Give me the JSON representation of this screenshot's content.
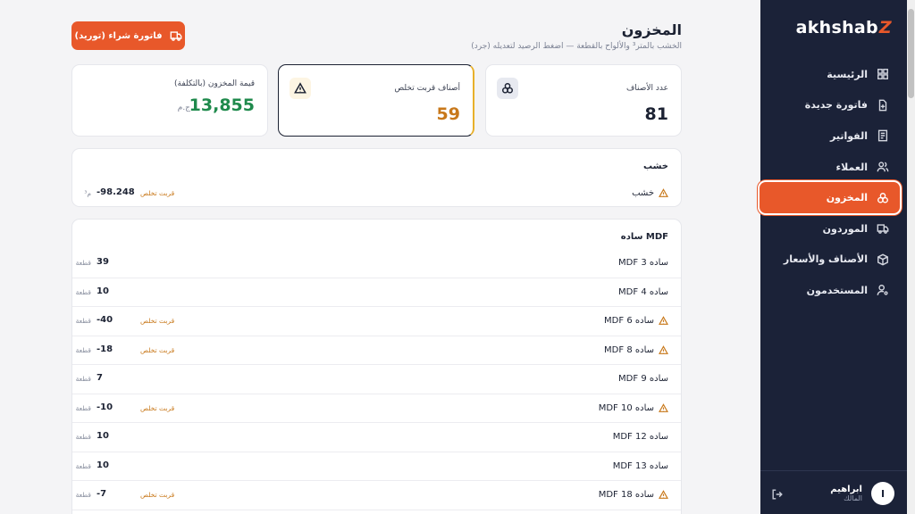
{
  "sidebar": {
    "logo_text": "akhshab",
    "logo_mark": "Z",
    "items": [
      {
        "label": "الرئيسية",
        "icon": "grid-icon"
      },
      {
        "label": "فاتورة جديدة",
        "icon": "file-plus-icon"
      },
      {
        "label": "الفواتير",
        "icon": "receipt-icon"
      },
      {
        "label": "العملاء",
        "icon": "users-icon"
      },
      {
        "label": "المخزون",
        "icon": "layers-icon",
        "active": true
      },
      {
        "label": "الموردون",
        "icon": "truck-icon"
      },
      {
        "label": "الأصناف والأسعار",
        "icon": "box-icon"
      },
      {
        "label": "المستخدمون",
        "icon": "user-cog-icon"
      }
    ],
    "user": {
      "initial": "I",
      "name": "ابراهيم",
      "role": "المالك"
    }
  },
  "header": {
    "title": "المخزون",
    "subtitle": "الخشب بالمتر³ والألواح بالقطعة — اضغط الرصيد لتعديله (جرد)",
    "purchase_button": "فاتورة شراء (توريد)"
  },
  "stats": {
    "item_count_label": "عدد الأصناف",
    "item_count_value": "81",
    "low_stock_label": "أصناف قربت تخلص",
    "low_stock_value": "59",
    "stock_value_label": "قيمة المخزون (بالتكلفة)",
    "stock_value_value": "13,855",
    "stock_value_currency": "ج.م"
  },
  "groups": {
    "wood": {
      "title": "خشب",
      "rows": [
        {
          "name": "خشب",
          "qty": "-98.248",
          "unit": "م³",
          "badge": "قربت تخلص",
          "warn": true
        }
      ]
    },
    "mdf": {
      "title": "MDF ساده",
      "rows": [
        {
          "name": "ساده 3 MDF",
          "qty": "39",
          "unit": "قطعة",
          "badge": "",
          "warn": false
        },
        {
          "name": "ساده 4 MDF",
          "qty": "10",
          "unit": "قطعة",
          "badge": "",
          "warn": false
        },
        {
          "name": "ساده 6 MDF",
          "qty": "-40",
          "unit": "قطعة",
          "badge": "قربت تخلص",
          "warn": true
        },
        {
          "name": "ساده 8 MDF",
          "qty": "-18",
          "unit": "قطعة",
          "badge": "قربت تخلص",
          "warn": true
        },
        {
          "name": "ساده 9 MDF",
          "qty": "7",
          "unit": "قطعة",
          "badge": "",
          "warn": false
        },
        {
          "name": "ساده 10 MDF",
          "qty": "-10",
          "unit": "قطعة",
          "badge": "قربت تخلص",
          "warn": true
        },
        {
          "name": "ساده 12 MDF",
          "qty": "10",
          "unit": "قطعة",
          "badge": "",
          "warn": false
        },
        {
          "name": "ساده 13 MDF",
          "qty": "10",
          "unit": "قطعة",
          "badge": "",
          "warn": false
        },
        {
          "name": "ساده 18 MDF",
          "qty": "-7",
          "unit": "قطعة",
          "badge": "قربت تخلص",
          "warn": true
        }
      ]
    }
  },
  "colors": {
    "accent": "#e8582a",
    "sidebar": "#1b2238",
    "warning": "#c8781a",
    "success": "#1f8a4c"
  }
}
